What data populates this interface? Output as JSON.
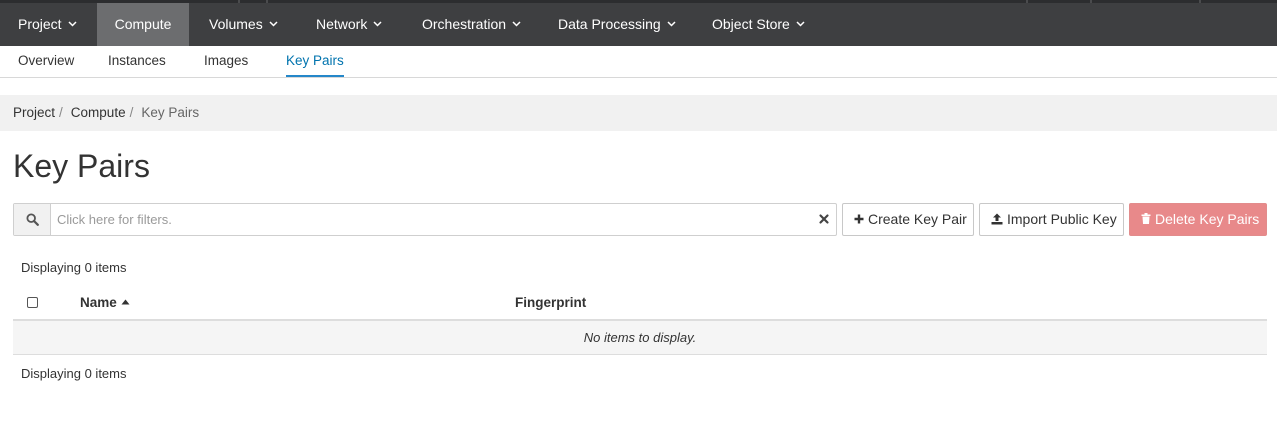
{
  "topnav": {
    "tabs": [
      {
        "label": "Project",
        "dropdown": true,
        "active": false
      },
      {
        "label": "Compute",
        "dropdown": false,
        "active": true
      },
      {
        "label": "Volumes",
        "dropdown": true,
        "active": false
      },
      {
        "label": "Network",
        "dropdown": true,
        "active": false
      },
      {
        "label": "Orchestration",
        "dropdown": true,
        "active": false
      },
      {
        "label": "Data Processing",
        "dropdown": true,
        "active": false
      },
      {
        "label": "Object Store",
        "dropdown": true,
        "active": false
      }
    ]
  },
  "subnav": {
    "items": [
      {
        "label": "Overview",
        "active": false
      },
      {
        "label": "Instances",
        "active": false
      },
      {
        "label": "Images",
        "active": false
      },
      {
        "label": "Key Pairs",
        "active": true
      }
    ]
  },
  "breadcrumb": {
    "items": [
      "Project",
      "Compute"
    ],
    "separator": "/",
    "current": "Key Pairs"
  },
  "page": {
    "title": "Key Pairs"
  },
  "filter": {
    "placeholder": "Click here for filters.",
    "value": ""
  },
  "actions": {
    "create_label": "Create Key Pair",
    "import_label": "Import Public Key",
    "delete_label": "Delete Key Pairs"
  },
  "table": {
    "count_top": "Displaying 0 items",
    "count_bottom": "Displaying 0 items",
    "columns": {
      "name": "Name",
      "fingerprint": "Fingerprint"
    },
    "empty_message": "No items to display."
  },
  "colors": {
    "topnav_bg": "#3e3f41",
    "topnav_active": "#6c6d6f",
    "accent": "#0073ae",
    "danger_disabled": "#e8898a"
  },
  "icons": {
    "search": "search-icon",
    "clear": "close-icon",
    "create": "plus-icon",
    "import": "upload-icon",
    "delete": "trash-icon",
    "sort": "caret-up-icon",
    "dropdown": "chevron-down-icon"
  }
}
